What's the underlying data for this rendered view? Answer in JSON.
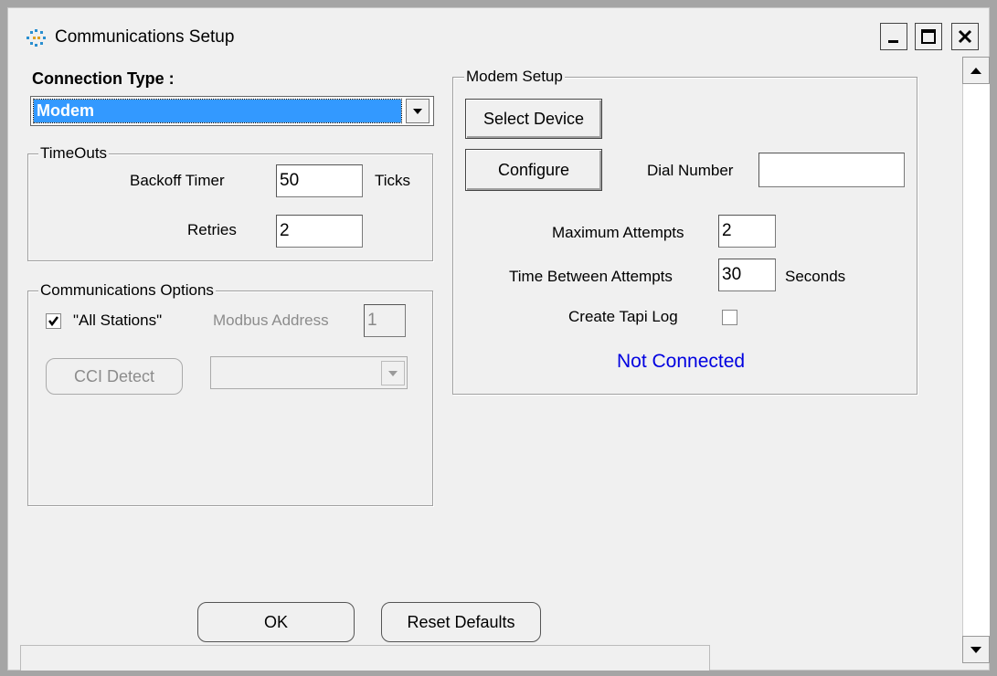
{
  "window": {
    "title": "Communications Setup",
    "minimize_glyph": "_",
    "close_glyph": "×"
  },
  "connection": {
    "label": "Connection Type :",
    "selected": "Modem"
  },
  "timeouts": {
    "legend": "TimeOuts",
    "backoff_label": "Backoff Timer",
    "backoff_value": "50",
    "backoff_unit": "Ticks",
    "retries_label": "Retries",
    "retries_value": "2"
  },
  "comm_options": {
    "legend": "Communications Options",
    "all_stations_label": "\"All Stations\"",
    "all_stations_checked": true,
    "modbus_label": "Modbus Address",
    "modbus_value": "1",
    "cci_button": "CCI Detect",
    "cci_select_value": ""
  },
  "modem": {
    "legend": "Modem Setup",
    "select_device": "Select Device",
    "configure": "Configure",
    "dial_label": "Dial Number",
    "dial_value": "",
    "max_attempts_label": "Maximum Attempts",
    "max_attempts_value": "2",
    "time_between_label": "Time Between Attempts",
    "time_between_value": "30",
    "time_unit": "Seconds",
    "tapi_label": "Create Tapi Log",
    "tapi_checked": false,
    "status": "Not Connected",
    "status_color": "#0000e0"
  },
  "footer": {
    "ok": "OK",
    "reset": "Reset Defaults"
  },
  "colors": {
    "selection": "#3399ff"
  },
  "icons": {
    "app": "communications-icon",
    "minimize": "minimize-icon",
    "maximize": "maximize-icon",
    "close": "close-icon",
    "dropdown": "chevron-down-icon",
    "scroll_up": "scroll-up-arrow-icon",
    "scroll_down": "scroll-down-arrow-icon"
  }
}
